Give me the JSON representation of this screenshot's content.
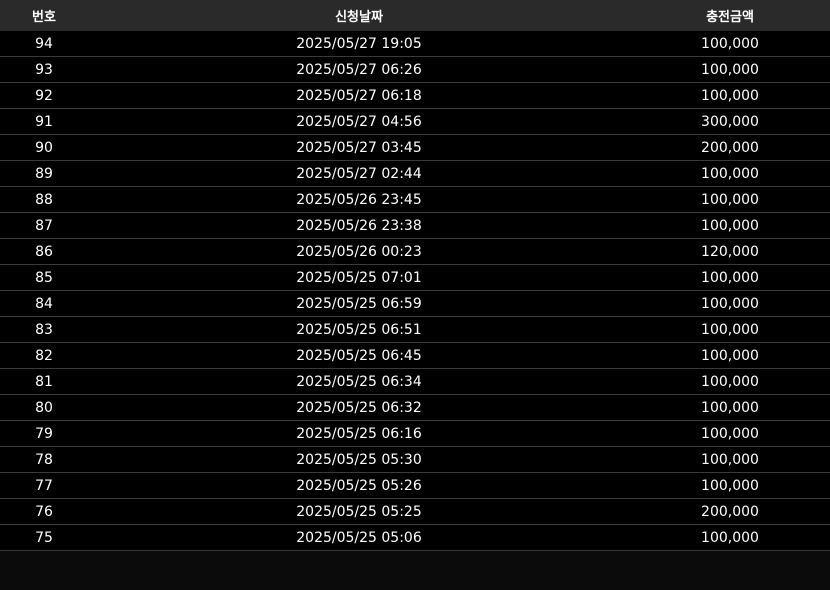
{
  "table": {
    "headers": {
      "number": "번호",
      "date": "신청날짜",
      "amount": "충전금액"
    },
    "rows": [
      {
        "number": "94",
        "date": "2025/05/27 19:05",
        "amount": "100,000"
      },
      {
        "number": "93",
        "date": "2025/05/27 06:26",
        "amount": "100,000"
      },
      {
        "number": "92",
        "date": "2025/05/27 06:18",
        "amount": "100,000"
      },
      {
        "number": "91",
        "date": "2025/05/27 04:56",
        "amount": "300,000"
      },
      {
        "number": "90",
        "date": "2025/05/27 03:45",
        "amount": "200,000"
      },
      {
        "number": "89",
        "date": "2025/05/27 02:44",
        "amount": "100,000"
      },
      {
        "number": "88",
        "date": "2025/05/26 23:45",
        "amount": "100,000"
      },
      {
        "number": "87",
        "date": "2025/05/26 23:38",
        "amount": "100,000"
      },
      {
        "number": "86",
        "date": "2025/05/26 00:23",
        "amount": "120,000"
      },
      {
        "number": "85",
        "date": "2025/05/25 07:01",
        "amount": "100,000"
      },
      {
        "number": "84",
        "date": "2025/05/25 06:59",
        "amount": "100,000"
      },
      {
        "number": "83",
        "date": "2025/05/25 06:51",
        "amount": "100,000"
      },
      {
        "number": "82",
        "date": "2025/05/25 06:45",
        "amount": "100,000"
      },
      {
        "number": "81",
        "date": "2025/05/25 06:34",
        "amount": "100,000"
      },
      {
        "number": "80",
        "date": "2025/05/25 06:32",
        "amount": "100,000"
      },
      {
        "number": "79",
        "date": "2025/05/25 06:16",
        "amount": "100,000"
      },
      {
        "number": "78",
        "date": "2025/05/25 05:30",
        "amount": "100,000"
      },
      {
        "number": "77",
        "date": "2025/05/25 05:26",
        "amount": "100,000"
      },
      {
        "number": "76",
        "date": "2025/05/25 05:25",
        "amount": "200,000"
      },
      {
        "number": "75",
        "date": "2025/05/25 05:06",
        "amount": "100,000"
      }
    ]
  },
  "colors": {
    "background": "#0b0b0b",
    "header_background": "#2a2a2a",
    "row_background": "#000000",
    "row_divider": "#3a3a3a",
    "text": "#ffffff"
  }
}
